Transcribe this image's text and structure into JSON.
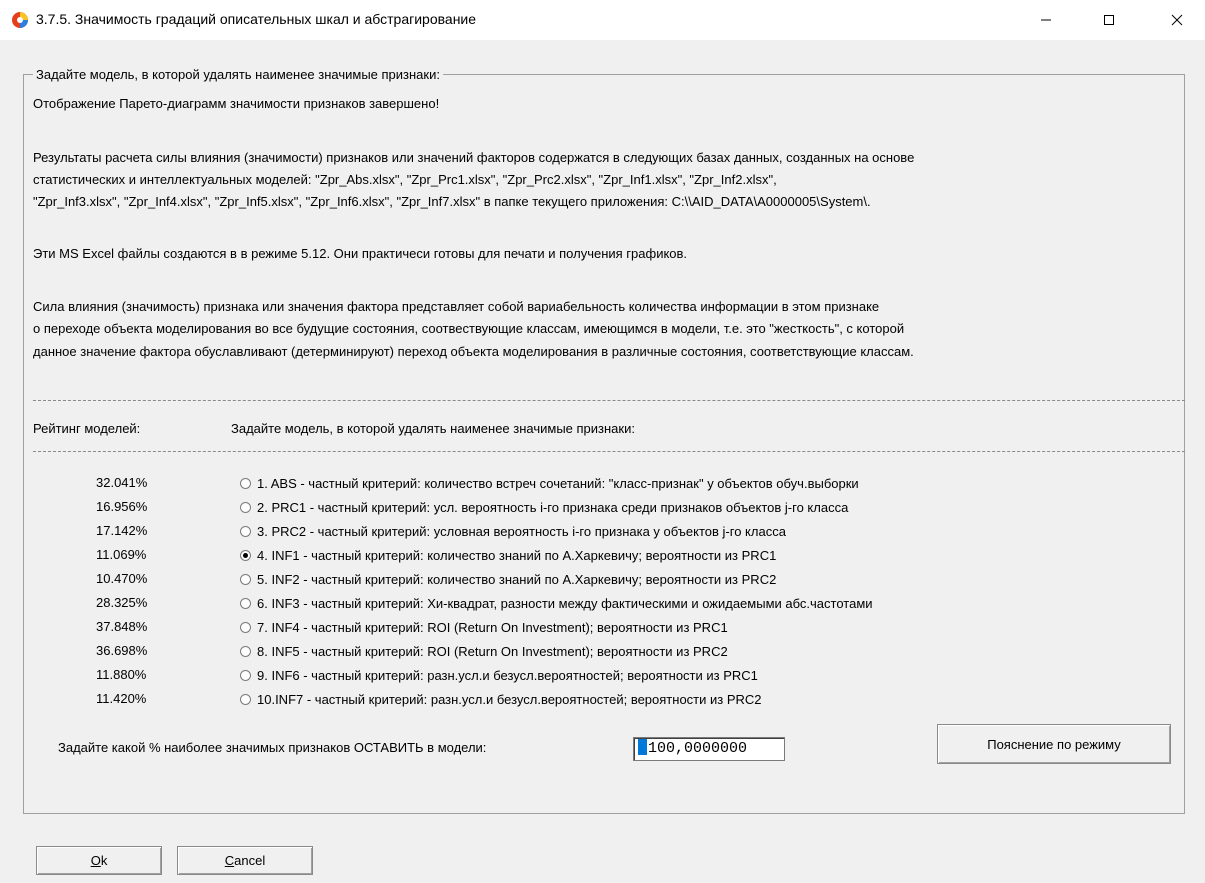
{
  "window": {
    "title": "3.7.5. Значимость градаций описательных шкал и абстрагирование"
  },
  "group": {
    "legend": "Задайте модель, в которой удалять наименее значимые признаки:"
  },
  "info": {
    "line1": "Отображение Парето-диаграмм значимости признаков завершено!",
    "para2": [
      "Результаты расчета силы влияния (значимости) признаков или значений факторов содержатся в следующих базах данных, созданных на основе",
      "статистических и интеллектуальных моделей: \"Zpr_Abs.xlsx\", \"Zpr_Prc1.xlsx\", \"Zpr_Prc2.xlsx\", \"Zpr_Inf1.xlsx\", \"Zpr_Inf2.xlsx\",",
      "\"Zpr_Inf3.xlsx\", \"Zpr_Inf4.xlsx\", \"Zpr_Inf5.xlsx\", \"Zpr_Inf6.xlsx\", \"Zpr_Inf7.xlsx\" в папке текущего приложения: C:\\\\AID_DATA\\A0000005\\System\\."
    ],
    "line3": "Эти MS Excel файлы создаются в в режиме 5.12. Они практичеси готовы для печати и получения графиков.",
    "para4": [
      "Сила влияния (значимость) признака или значения фактора представляет собой вариабельность количества информации в этом признаке",
      "о переходе объекта моделирования во все будущие состояния, соотвествующие классам, имеющимся в модели, т.е. это \"жесткость\", с которой",
      "данное значение фактора обуславливают (детерминируют) переход объекта моделирования в различные состояния, соответствующие классам."
    ]
  },
  "headers": {
    "rating": "Рейтинг моделей:",
    "choose": "Задайте модель, в которой удалять наименее значимые признаки:"
  },
  "models": [
    {
      "pct": "32.041%",
      "label": "1. ABS  - частный критерий: количество встреч сочетаний: \"класс-признак\" у объектов обуч.выборки",
      "checked": false
    },
    {
      "pct": "16.956%",
      "label": "2. PRC1 - частный критерий: усл. вероятность i-го признака среди признаков объектов j-го класса",
      "checked": false
    },
    {
      "pct": "17.142%",
      "label": "3. PRC2 - частный критерий: условная вероятность i-го признака у объектов j-го класса",
      "checked": false
    },
    {
      "pct": "11.069%",
      "label": "4. INF1 - частный критерий: количество знаний по А.Харкевичу; вероятности из PRC1",
      "checked": true
    },
    {
      "pct": "10.470%",
      "label": "5. INF2 - частный критерий: количество знаний по А.Харкевичу; вероятности из PRC2",
      "checked": false
    },
    {
      "pct": "28.325%",
      "label": "6. INF3 - частный критерий: Хи-квадрат, разности между фактическими и ожидаемыми абс.частотами",
      "checked": false
    },
    {
      "pct": "37.848%",
      "label": "7. INF4 - частный критерий: ROI (Return On Investment); вероятности из PRC1",
      "checked": false
    },
    {
      "pct": "36.698%",
      "label": "8. INF5 - частный критерий: ROI (Return On Investment); вероятности из PRC2",
      "checked": false
    },
    {
      "pct": "11.880%",
      "label": "9. INF6 - частный критерий: разн.усл.и безусл.вероятностей; вероятности из PRC1",
      "checked": false
    },
    {
      "pct": "11.420%",
      "label": "10.INF7 - частный критерий: разн.усл.и безусл.вероятностей; вероятности из PRC2",
      "checked": false
    }
  ],
  "keep": {
    "label": "Задайте какой % наиболее значимых признаков ОСТАВИТЬ в модели:",
    "value": "100,0000000"
  },
  "buttons": {
    "help": "Пояснение по режиму",
    "ok_mnemonic": "O",
    "ok_rest": "k",
    "cancel_mnemonic": "C",
    "cancel_rest": "ancel"
  }
}
